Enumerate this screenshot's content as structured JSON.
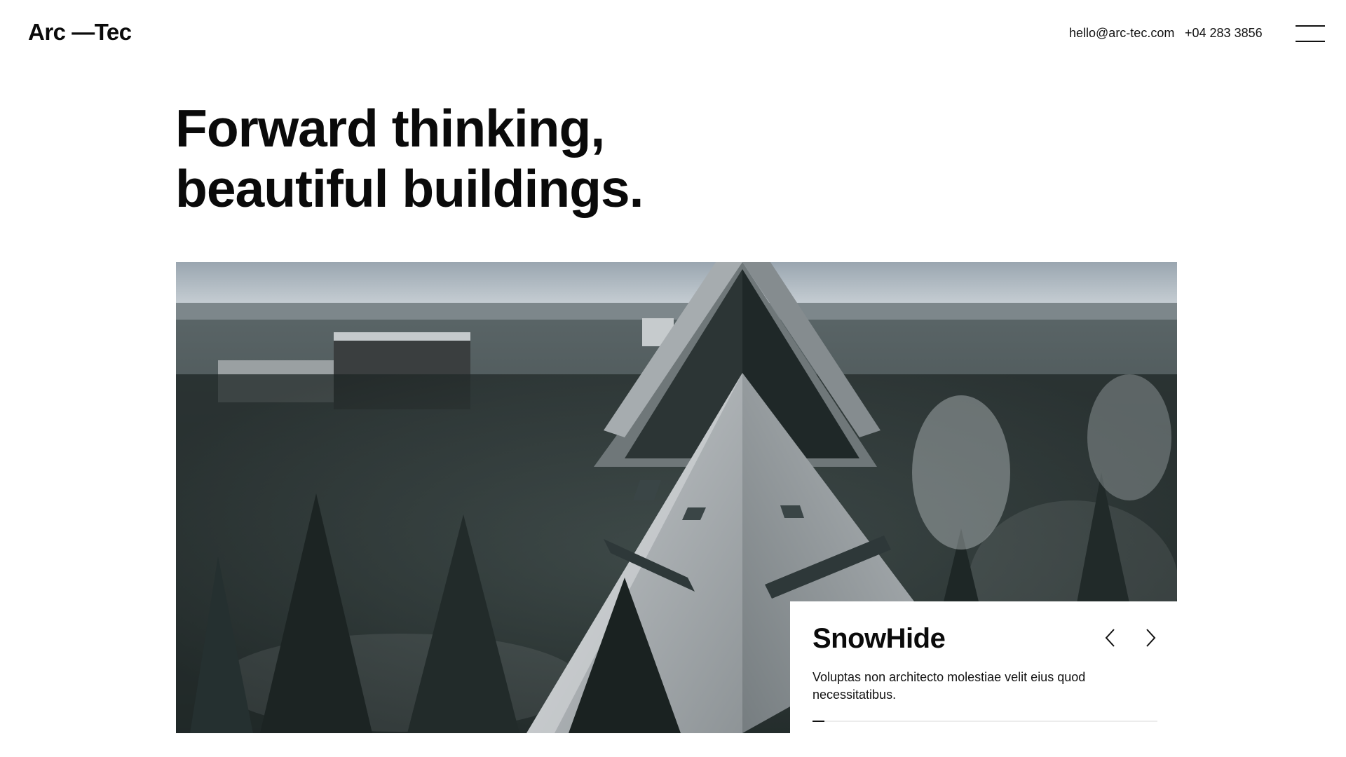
{
  "header": {
    "logo": "Arc —Tec",
    "email": "hello@arc-tec.com",
    "phone": "+04 283 3856",
    "menu_icon": "hamburger-menu-icon"
  },
  "hero": {
    "headline_line1": "Forward thinking,",
    "headline_line2": "beautiful buildings."
  },
  "project_card": {
    "title": "SnowHide",
    "description": "Voluptas non architecto molestiae velit eius quod necessitatibus.",
    "prev_icon": "chevron-left-icon",
    "next_icon": "chevron-right-icon",
    "progress": 0.035
  },
  "colors": {
    "text": "#0b0b0b",
    "background": "#ffffff",
    "sky": "#b8c2ca",
    "forest": "#2f3a3a",
    "roof": "#aeb3b6"
  }
}
